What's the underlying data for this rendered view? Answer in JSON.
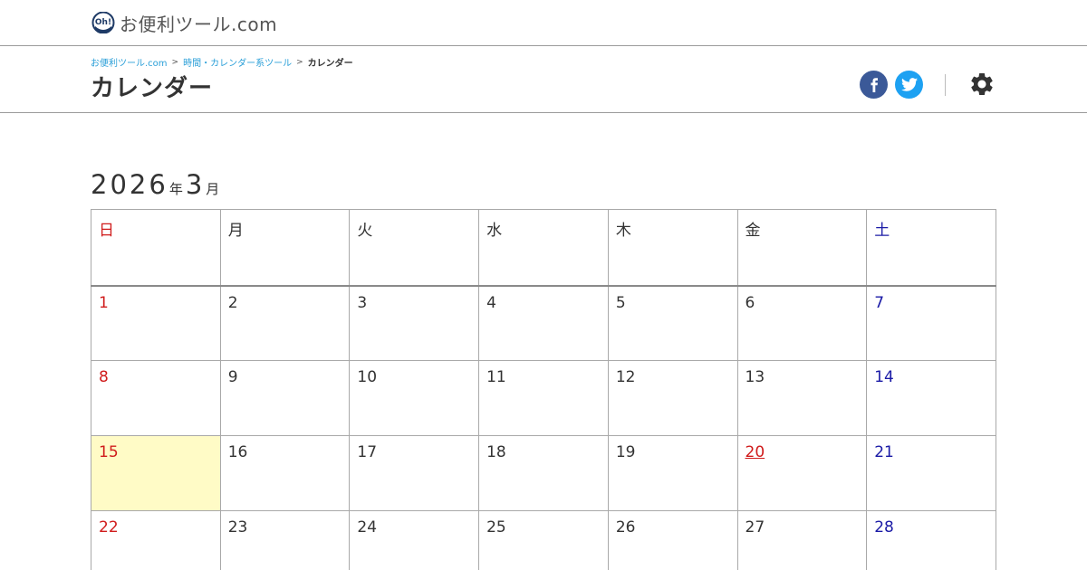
{
  "site": {
    "logo_text": "お便利ツール.com",
    "logo_mark_text": "Oh!"
  },
  "breadcrumb": {
    "home": "お便利ツール.com",
    "category": "時間・カレンダー系ツール",
    "current": "カレンダー",
    "separator": ">"
  },
  "page": {
    "title": "カレンダー"
  },
  "share": {
    "facebook_icon": "facebook-icon",
    "twitter_icon": "twitter-icon",
    "settings_icon": "gear-icon"
  },
  "calendar": {
    "year": "2026",
    "year_suffix": "年",
    "month": "3",
    "month_suffix": "月",
    "weekdays": [
      "日",
      "月",
      "火",
      "水",
      "木",
      "金",
      "土"
    ],
    "weeks": [
      [
        "1",
        "2",
        "3",
        "4",
        "5",
        "6",
        "7"
      ],
      [
        "8",
        "9",
        "10",
        "11",
        "12",
        "13",
        "14"
      ],
      [
        "15",
        "16",
        "17",
        "18",
        "19",
        "20",
        "21"
      ],
      [
        "22",
        "23",
        "24",
        "25",
        "26",
        "27",
        "28"
      ]
    ],
    "today": "15",
    "holidays": [
      "20"
    ]
  },
  "colors": {
    "sunday": "#d01c1c",
    "saturday": "#1a1aa6",
    "today_bg": "#fffbc6",
    "link": "#2a9fd8",
    "facebook": "#3b5998",
    "twitter": "#1da1f2"
  }
}
